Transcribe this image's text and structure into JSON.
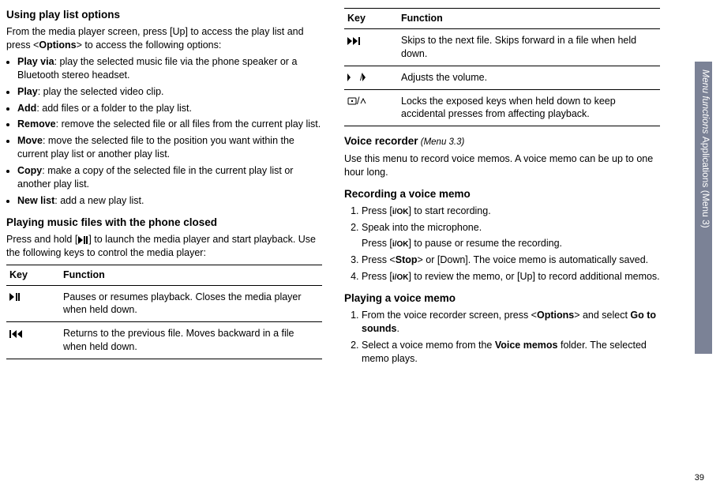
{
  "left": {
    "h_playlist": "Using play list options",
    "p_playlist_intro_1": "From the media player screen, press [Up] to access the play list and press <",
    "p_playlist_intro_b": "Options",
    "p_playlist_intro_2": "> to access the following options:",
    "bullets": [
      {
        "b": "Play via",
        "t": ": play the selected music file via the phone speaker or a Bluetooth stereo headset."
      },
      {
        "b": "Play",
        "t": ": play the selected video clip."
      },
      {
        "b": "Add",
        "t": ": add files or a folder to the play list."
      },
      {
        "b": "Remove",
        "t": ": remove the selected file or all files from the current play list."
      },
      {
        "b": "Move",
        "t": ": move the selected file to the position you want within the current play list or another play list."
      },
      {
        "b": "Copy",
        "t": ": make a copy of the selected file in the current play list or another play list."
      },
      {
        "b": "New list",
        "t": ": add a new play list."
      }
    ],
    "h_closed": "Playing music files with the phone closed",
    "p_closed_1a": "Press and hold [",
    "p_closed_1b": "] to launch the media player and start playback. Use the following keys to control the media player:",
    "table_hdr_key": "Key",
    "table_hdr_func": "Function",
    "row1_func": "Pauses or resumes playback. Closes the media player when held down.",
    "row2_func": "Returns to the previous file. Moves backward in a file when held down."
  },
  "right": {
    "table_hdr_key": "Key",
    "table_hdr_func": "Function",
    "row3_func": "Skips to the next file. Skips forward in a file when held down.",
    "row4_func": "Adjusts the volume.",
    "row5_func": "Locks the exposed keys when held down to keep accidental presses from affecting playback.",
    "h_voice": "Voice recorder",
    "menu_ref": " (Menu 3.3)",
    "p_voice_intro": "Use this menu to record voice memos. A voice memo can be up to one hour long.",
    "h_record": "Recording a voice memo",
    "rec_1a": "Press [",
    "rec_1b": "] to start recording.",
    "rec_2a": "Speak into the microphone.",
    "rec_2b_a": "Press [",
    "rec_2b_b": "] to pause or resume the recording.",
    "rec_3a": "Press <",
    "rec_3b": "Stop",
    "rec_3c": "> or [Down]. The voice memo is automatically saved.",
    "rec_4a": "Press [",
    "rec_4b": "] to review the memo, or [Up] to record additional memos.",
    "h_play": "Playing a voice memo",
    "play_1a": "From the voice recorder screen, press <",
    "play_1b": "Options",
    "play_1c": "> and select ",
    "play_1d": "Go to sounds",
    "play_1e": ".",
    "play_2a": "Select a voice memo from the ",
    "play_2b": "Voice memos",
    "play_2c": " folder. The selected memo plays."
  },
  "sidebar": {
    "italic": "Menu functions    ",
    "normal": "Applications (Menu 3)"
  },
  "page_num": "39"
}
